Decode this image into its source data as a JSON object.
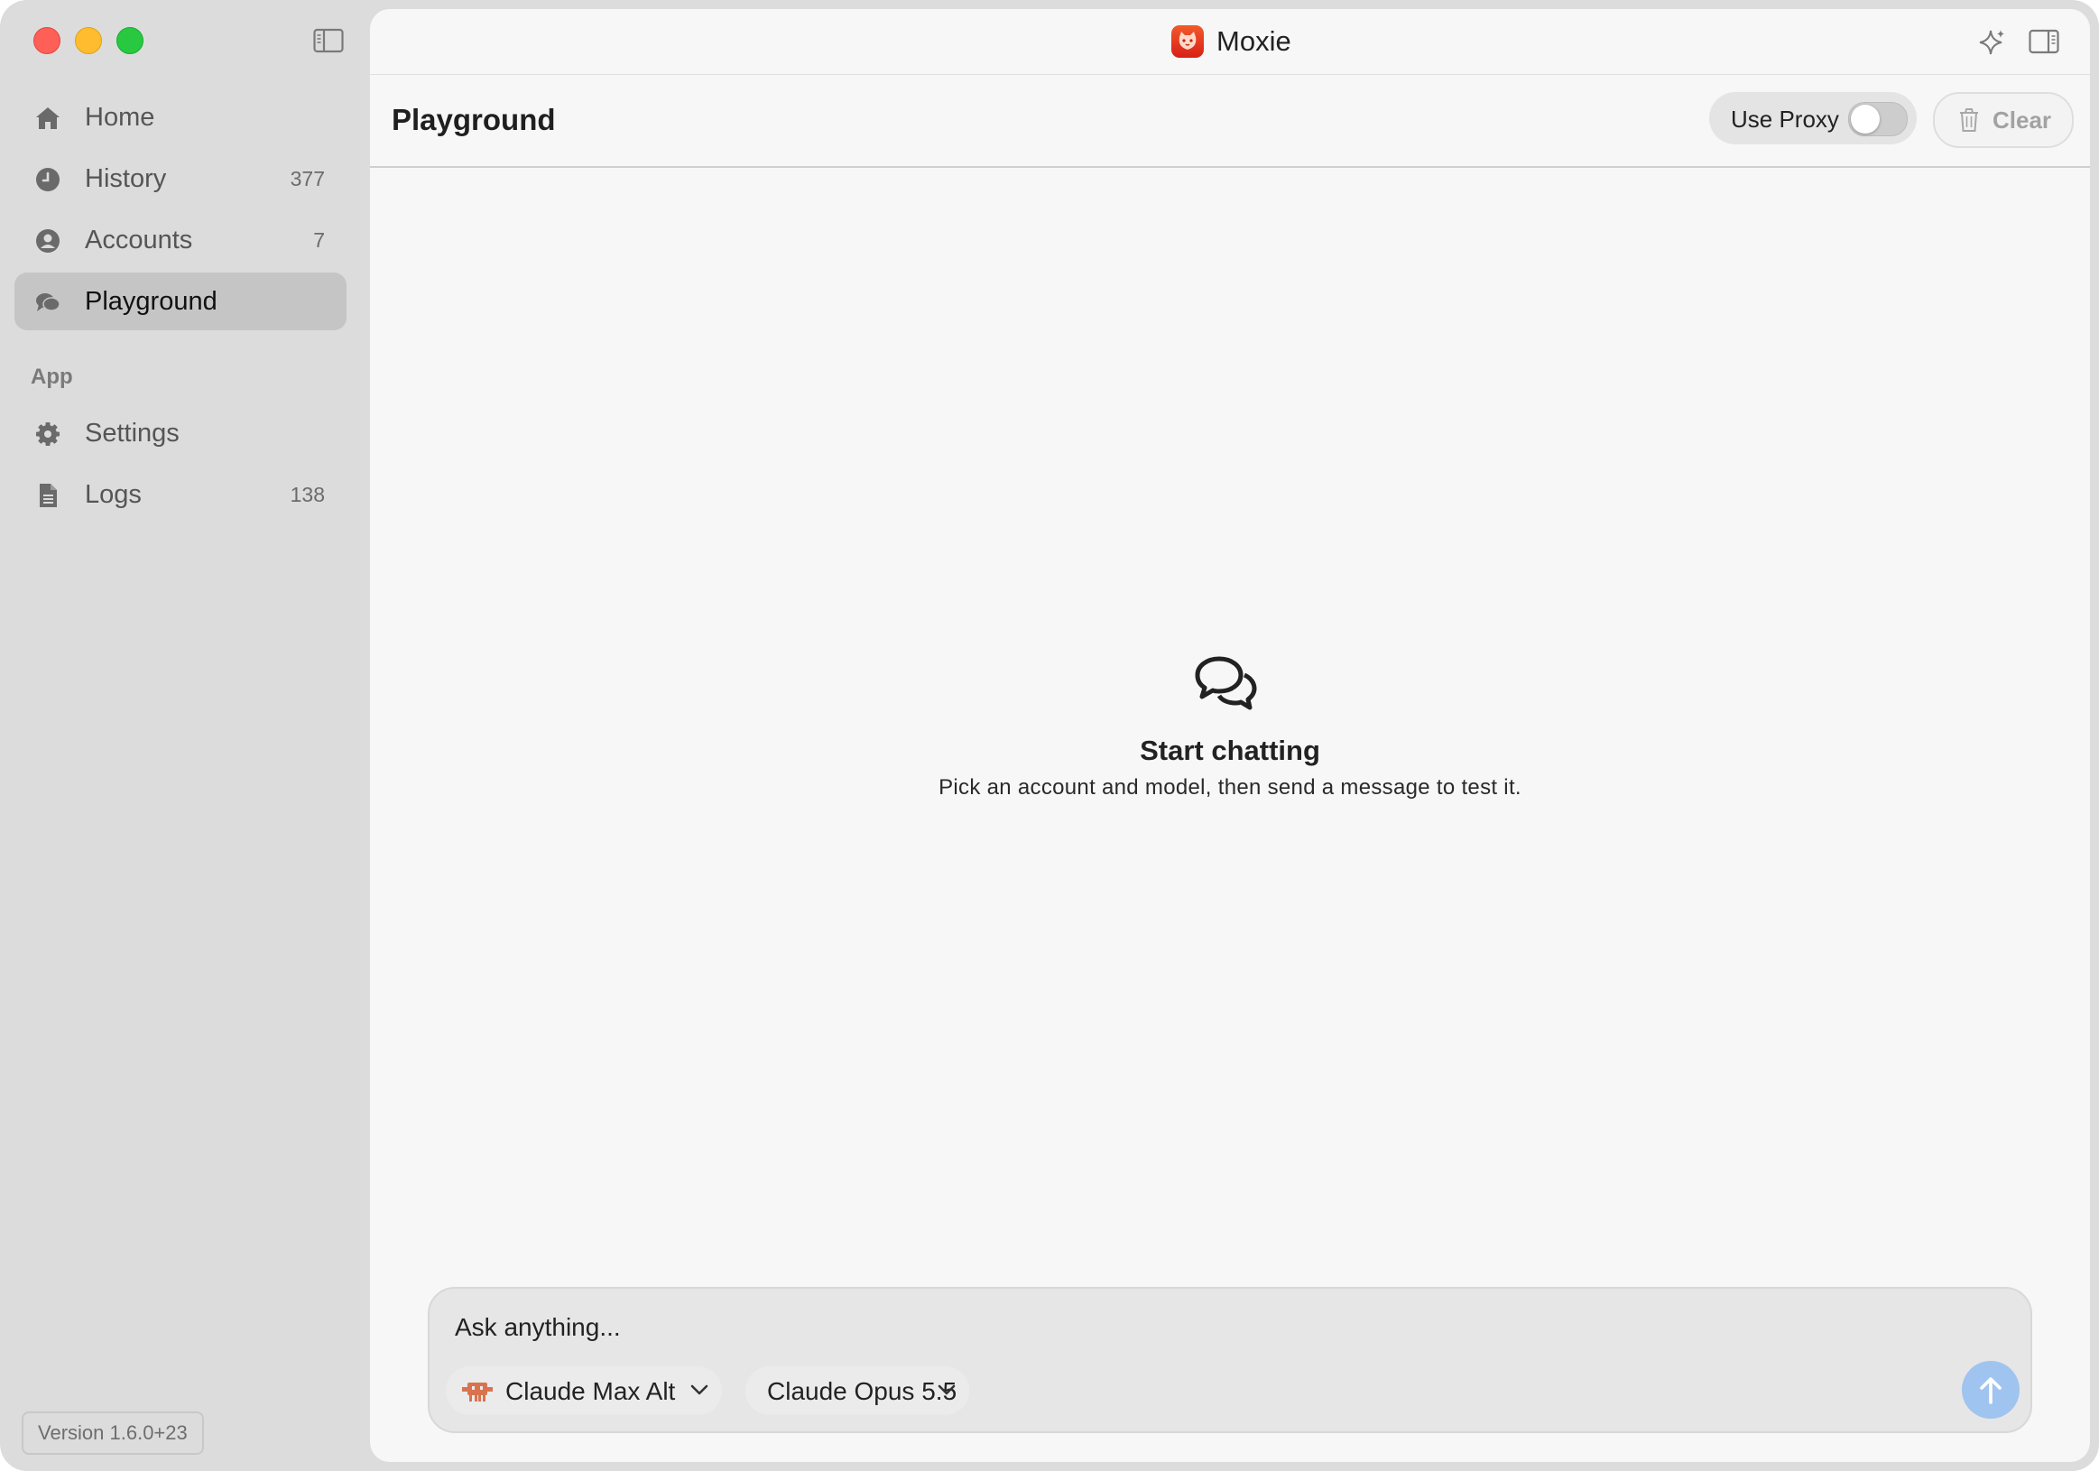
{
  "app": {
    "title": "Moxie",
    "accent": "#9fc4f0",
    "logo_color": "#e0301e"
  },
  "sidebar": {
    "items": [
      {
        "label": "Home",
        "count": "",
        "icon": "house-icon"
      },
      {
        "label": "History",
        "count": "377",
        "icon": "clock-icon"
      },
      {
        "label": "Accounts",
        "count": "7",
        "icon": "person-circle-icon"
      },
      {
        "label": "Playground",
        "count": "",
        "icon": "chat-bubbles-icon",
        "active": true
      }
    ],
    "section_label": "App",
    "app_items": [
      {
        "label": "Settings",
        "count": "",
        "icon": "gear-icon"
      },
      {
        "label": "Logs",
        "count": "138",
        "icon": "document-icon"
      }
    ],
    "version": "Version 1.6.0+23"
  },
  "toolbar": {
    "page_title": "Playground",
    "proxy_label": "Use Proxy",
    "proxy_enabled": false,
    "clear_label": "Clear"
  },
  "empty_state": {
    "icon": "chat-bubbles-icon",
    "title": "Start chatting",
    "subtitle": "Pick an account and model, then send a message to test it."
  },
  "composer": {
    "placeholder": "Ask anything...",
    "account_picker": {
      "label": "Claude Max Alt",
      "icon": "robot-icon"
    },
    "model_picker": {
      "label": "Claude Opus 5.5"
    },
    "send_icon": "arrow-up-icon"
  }
}
